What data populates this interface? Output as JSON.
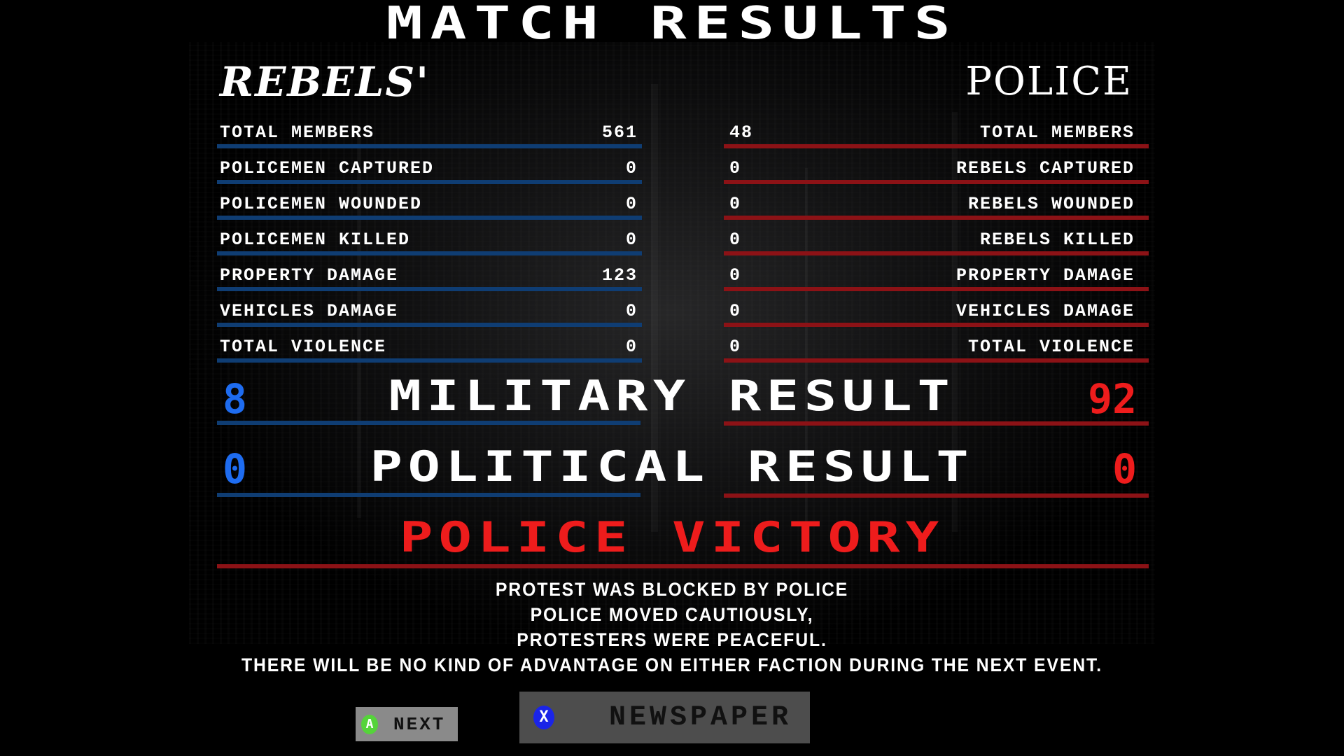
{
  "title": "MATCH RESULTS",
  "factions": {
    "rebels": {
      "name": "REBELS'",
      "color": "#1e6cf0"
    },
    "police": {
      "name": "POLICE",
      "color": "#ee1c1c"
    }
  },
  "rebels_stats": [
    {
      "label": "TOTAL MEMBERS",
      "value": "561"
    },
    {
      "label": "POLICEMEN CAPTURED",
      "value": "0"
    },
    {
      "label": "POLICEMEN WOUNDED",
      "value": "0"
    },
    {
      "label": "POLICEMEN KILLED",
      "value": "0"
    },
    {
      "label": "PROPERTY DAMAGE",
      "value": "123"
    },
    {
      "label": "VEHICLES DAMAGE",
      "value": "0"
    },
    {
      "label": "TOTAL VIOLENCE",
      "value": "0"
    }
  ],
  "police_stats": [
    {
      "label": "TOTAL MEMBERS",
      "value": "48"
    },
    {
      "label": "REBELS CAPTURED",
      "value": "0"
    },
    {
      "label": "REBELS WOUNDED",
      "value": "0"
    },
    {
      "label": "REBELS KILLED",
      "value": "0"
    },
    {
      "label": "PROPERTY DAMAGE",
      "value": "0"
    },
    {
      "label": "VEHICLES DAMAGE",
      "value": "0"
    },
    {
      "label": "TOTAL VIOLENCE",
      "value": "0"
    }
  ],
  "results": {
    "military": {
      "label": "MILITARY RESULT",
      "rebels": "8",
      "police": "92"
    },
    "political": {
      "label": "POLITICAL RESULT",
      "rebels": "0",
      "police": "0"
    }
  },
  "outcome": "POLICE VICTORY",
  "description": [
    "PROTEST WAS BLOCKED BY POLICE",
    "POLICE MOVED CAUTIOUSLY,",
    "PROTESTERS WERE PEACEFUL.",
    "THERE WILL BE NO KIND OF ADVANTAGE ON EITHER FACTION DURING THE NEXT EVENT."
  ],
  "buttons": {
    "next": {
      "glyph": "A",
      "label": "NEXT",
      "icon": "gamepad-a-button-icon"
    },
    "newspaper": {
      "glyph": "X",
      "label": "NEWSPAPER",
      "icon": "gamepad-x-button-icon"
    }
  }
}
